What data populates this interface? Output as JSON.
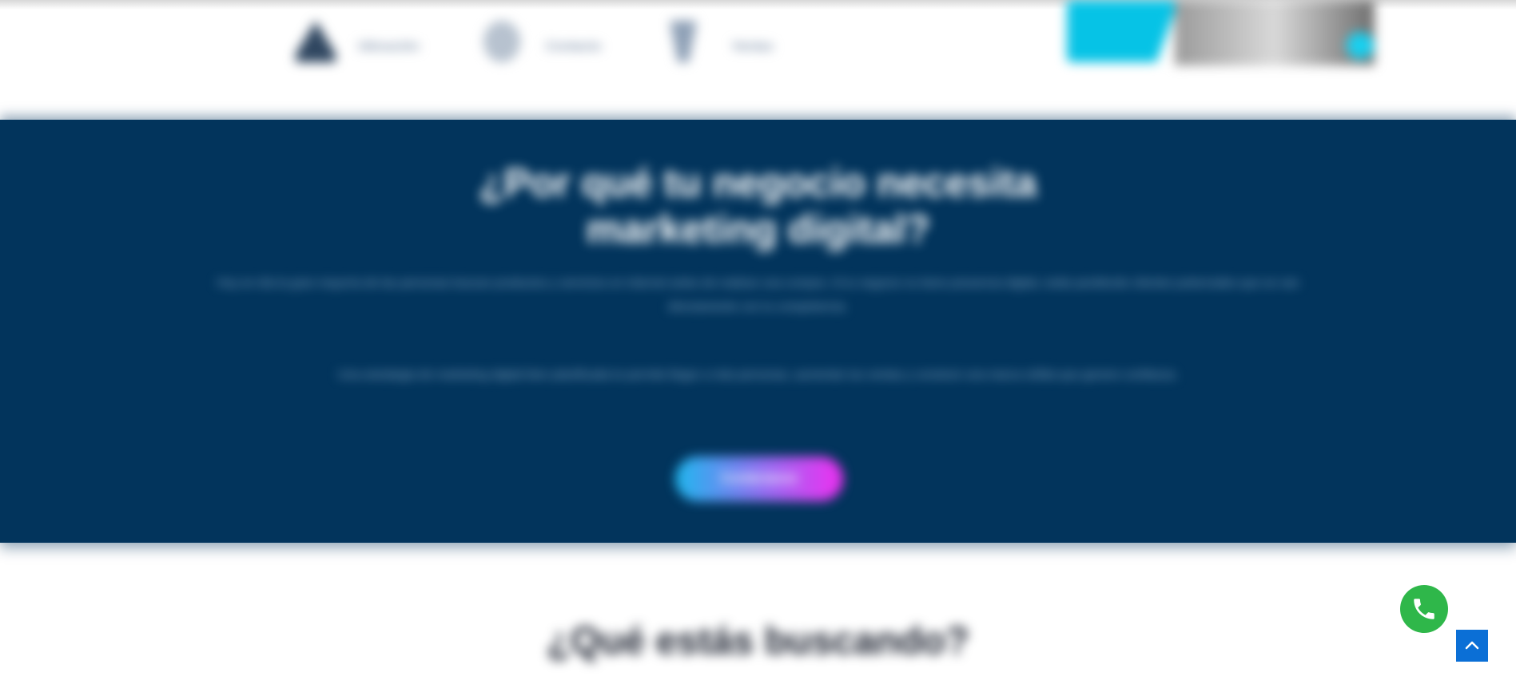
{
  "header": {
    "features": [
      {
        "icon": "tent-icon",
        "label": "Ubicación"
      },
      {
        "icon": "user-circle-icon",
        "label": "Contacto"
      },
      {
        "icon": "funnel-icon",
        "label": "Ventas"
      }
    ],
    "hero_image": "woman-with-laptop-image"
  },
  "section": {
    "title_line1": "¿Por qué tu negocio necesita",
    "title_line2": "marketing digital?",
    "paragraph1": "Hoy en día la gran mayoría de las personas buscan productos y servicios en internet antes de realizar una compra. Si tu negocio no tiene presencia digital, estás perdiendo clientes potenciales que se van directamente con tu competencia.",
    "paragraph2": "Una estrategia de marketing digital bien planificada te permite llegar a más personas, aumentar tus ventas y construir una marca sólida que genere confianza.",
    "cta_label": "Contáctanos",
    "background": "#02345c"
  },
  "lower": {
    "title": "¿Qué estás buscando?"
  },
  "floating": {
    "whatsapp_icon": "whatsapp-icon",
    "whatsapp_color": "#2fb74a",
    "scroll_top_icon": "chevron-up-icon",
    "scroll_top_color": "#0b6fd6"
  }
}
